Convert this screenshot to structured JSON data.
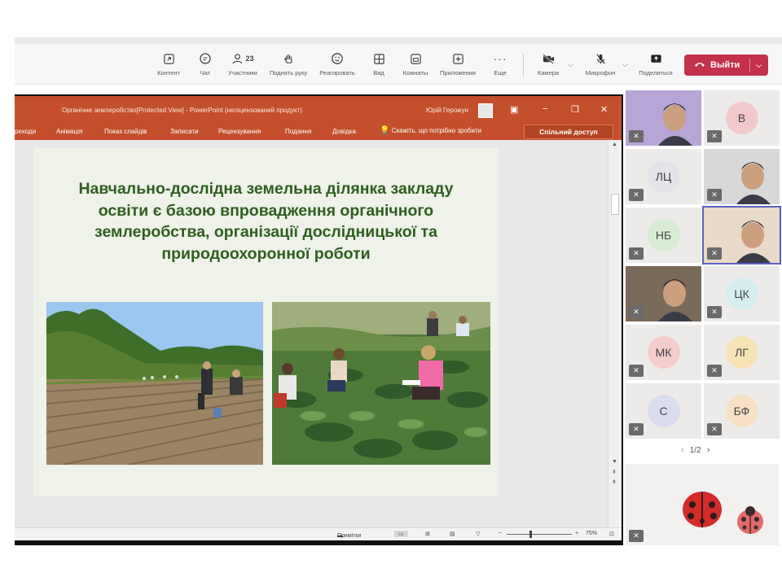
{
  "toolbar": {
    "items": [
      {
        "label": "Контент",
        "icon": "share-tray-icon"
      },
      {
        "label": "Чат",
        "icon": "chat-icon"
      },
      {
        "label": "Участники",
        "icon": "people-icon",
        "count": "23"
      },
      {
        "label": "Поднять руку",
        "icon": "hand-icon"
      },
      {
        "label": "Реагировать",
        "icon": "smile-icon"
      },
      {
        "label": "Вид",
        "icon": "grid-view-icon"
      },
      {
        "label": "Комнаты",
        "icon": "rooms-icon"
      },
      {
        "label": "Приложения",
        "icon": "plus-box-icon"
      },
      {
        "label": "Еще",
        "icon": "more-icon"
      },
      {
        "label": "Камера",
        "icon": "camera-off-icon"
      },
      {
        "label": "Микрофон",
        "icon": "mic-off-icon"
      },
      {
        "label": "Поделиться",
        "icon": "share-up-icon"
      }
    ],
    "leave_label": "Выйти"
  },
  "ppt": {
    "window_title": "Органічне землеробство[Protected View]  -  PowerPoint (неліцензований продукт)",
    "user": "Юрій Герожун",
    "tabs": [
      "реходи",
      "Анімація",
      "Показ слайдів",
      "Записати",
      "Рецензування",
      "Подання",
      "Довідка"
    ],
    "tell_me": "Скажіть, що потрібно зробити",
    "share_button": "Спільний доступ",
    "slide_title_lines": [
      "Навчально-дослідна земельна ділянка закладу",
      "освіти є базою впровадження органічного",
      "землеробства, організації дослідницької та",
      "природоохоронної роботи"
    ],
    "status_notes": "Примітки",
    "zoom": "75%"
  },
  "participants": [
    {
      "initials": "",
      "has_video": true,
      "color": "#b7a5d8"
    },
    {
      "initials": "В",
      "has_video": false,
      "color": "#f3c8cc"
    },
    {
      "initials": "ЛЦ",
      "has_video": false,
      "color": "#e3e3ea"
    },
    {
      "initials": "",
      "has_video": true,
      "color": "#d8d8d8"
    },
    {
      "initials": "НБ",
      "has_video": false,
      "color": "#d8ecd3"
    },
    {
      "initials": "",
      "has_video": true,
      "color": "#e9d9c9"
    },
    {
      "initials": "",
      "has_video": true,
      "color": "#7a6a5a"
    },
    {
      "initials": "ЦК",
      "has_video": false,
      "color": "#d6eef0"
    },
    {
      "initials": "МК",
      "has_video": false,
      "color": "#f4cccc"
    },
    {
      "initials": "ЛГ",
      "has_video": false,
      "color": "#f7e3b8"
    },
    {
      "initials": "С",
      "has_video": false,
      "color": "#dcdcef"
    },
    {
      "initials": "БФ",
      "has_video": false,
      "color": "#f7e1c4"
    }
  ],
  "pager": "1/2",
  "colors": {
    "leave": "#c4314b",
    "ppt_red": "#c44f2c",
    "slide_title": "#2f5e1f"
  }
}
